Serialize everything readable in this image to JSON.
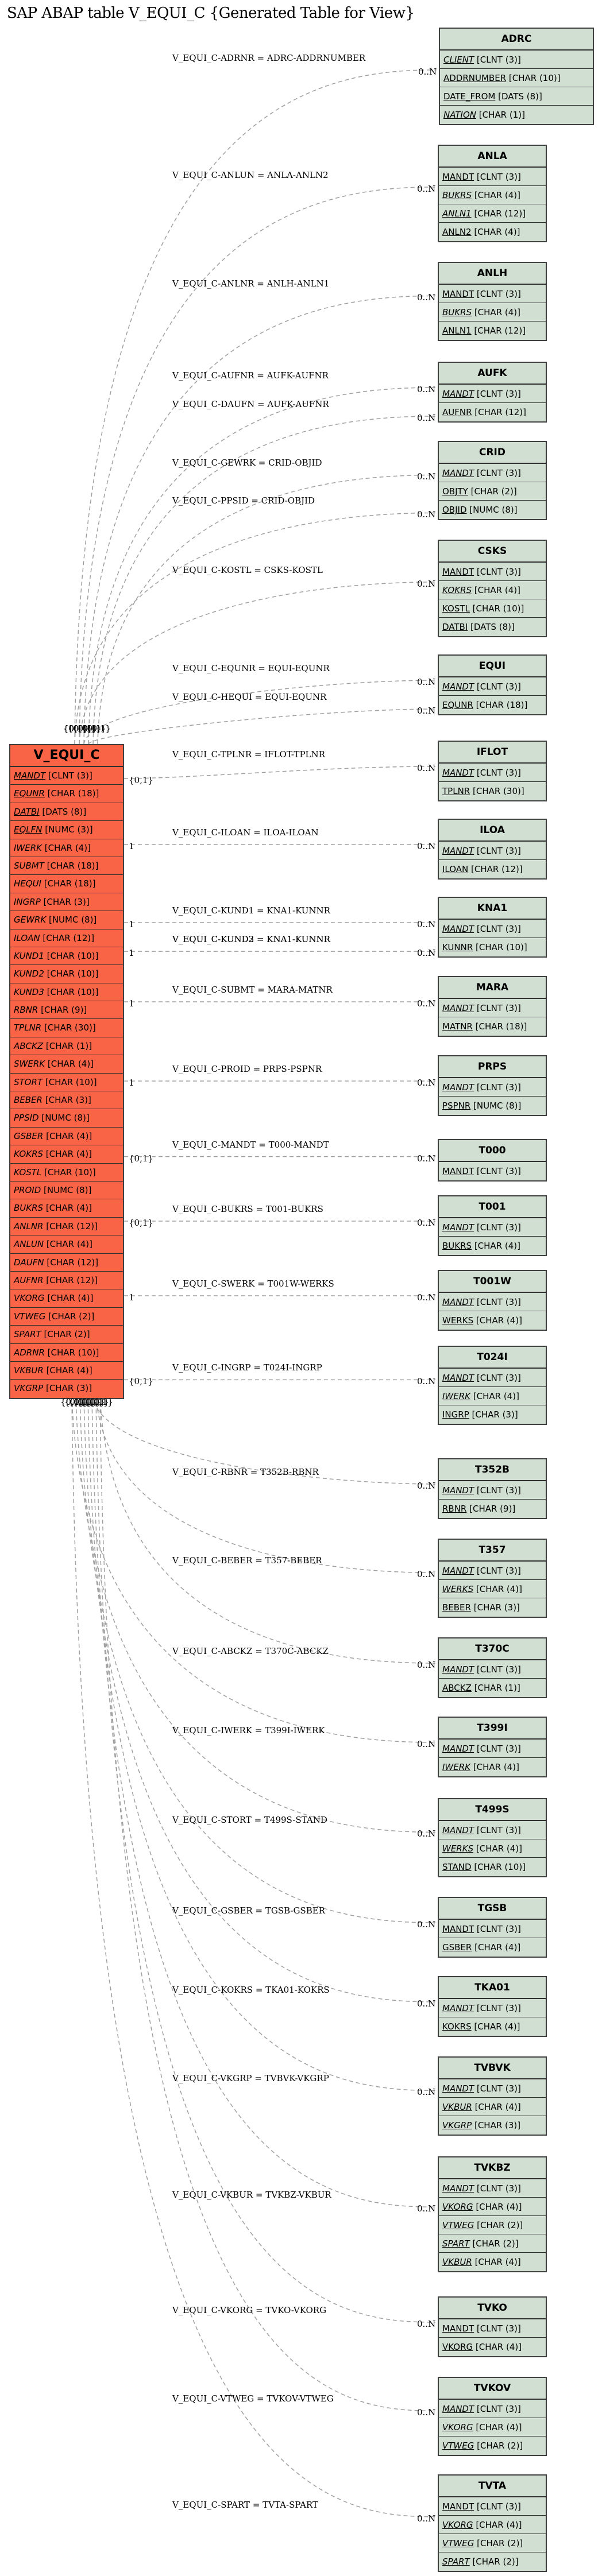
{
  "title": "SAP ABAP table V_EQUI_C {Generated Table for View}",
  "colors": {
    "main_fill": "#f96447",
    "ref_fill": "#d0dfd1",
    "edge": "#a0a0a0",
    "border": "#404040"
  },
  "main_entity": {
    "name": "V_EQUI_C",
    "fields": [
      {
        "name": "MANDT",
        "type": "[CLNT (3)]",
        "key": true
      },
      {
        "name": "EQUNR",
        "type": "[CHAR (18)]",
        "key": true
      },
      {
        "name": "DATBI",
        "type": "[DATS (8)]",
        "key": true
      },
      {
        "name": "EQLFN",
        "type": "[NUMC (3)]",
        "key": true
      },
      {
        "name": "IWERK",
        "type": "[CHAR (4)]",
        "key": false
      },
      {
        "name": "SUBMT",
        "type": "[CHAR (18)]",
        "key": false
      },
      {
        "name": "HEQUI",
        "type": "[CHAR (18)]",
        "key": false
      },
      {
        "name": "INGRP",
        "type": "[CHAR (3)]",
        "key": false
      },
      {
        "name": "GEWRK",
        "type": "[NUMC (8)]",
        "key": false
      },
      {
        "name": "ILOAN",
        "type": "[CHAR (12)]",
        "key": false
      },
      {
        "name": "KUND1",
        "type": "[CHAR (10)]",
        "key": false
      },
      {
        "name": "KUND2",
        "type": "[CHAR (10)]",
        "key": false
      },
      {
        "name": "KUND3",
        "type": "[CHAR (10)]",
        "key": false
      },
      {
        "name": "RBNR",
        "type": "[CHAR (9)]",
        "key": false
      },
      {
        "name": "TPLNR",
        "type": "[CHAR (30)]",
        "key": false
      },
      {
        "name": "ABCKZ",
        "type": "[CHAR (1)]",
        "key": false
      },
      {
        "name": "SWERK",
        "type": "[CHAR (4)]",
        "key": false
      },
      {
        "name": "STORT",
        "type": "[CHAR (10)]",
        "key": false
      },
      {
        "name": "BEBER",
        "type": "[CHAR (3)]",
        "key": false
      },
      {
        "name": "PPSID",
        "type": "[NUMC (8)]",
        "key": false
      },
      {
        "name": "GSBER",
        "type": "[CHAR (4)]",
        "key": false
      },
      {
        "name": "KOKRS",
        "type": "[CHAR (4)]",
        "key": false
      },
      {
        "name": "KOSTL",
        "type": "[CHAR (10)]",
        "key": false
      },
      {
        "name": "PROID",
        "type": "[NUMC (8)]",
        "key": false
      },
      {
        "name": "BUKRS",
        "type": "[CHAR (4)]",
        "key": false
      },
      {
        "name": "ANLNR",
        "type": "[CHAR (12)]",
        "key": false
      },
      {
        "name": "ANLUN",
        "type": "[CHAR (4)]",
        "key": false
      },
      {
        "name": "DAUFN",
        "type": "[CHAR (12)]",
        "key": false
      },
      {
        "name": "AUFNR",
        "type": "[CHAR (12)]",
        "key": false
      },
      {
        "name": "VKORG",
        "type": "[CHAR (4)]",
        "key": false
      },
      {
        "name": "VTWEG",
        "type": "[CHAR (2)]",
        "key": false
      },
      {
        "name": "SPART",
        "type": "[CHAR (2)]",
        "key": false
      },
      {
        "name": "ADRNR",
        "type": "[CHAR (10)]",
        "key": false
      },
      {
        "name": "VKBUR",
        "type": "[CHAR (4)]",
        "key": false
      },
      {
        "name": "VKGRP",
        "type": "[CHAR (3)]",
        "key": false
      }
    ]
  },
  "entities": [
    {
      "name": "ADRC",
      "fields": [
        {
          "name": "CLIENT",
          "type": "[CLNT (3)]",
          "italic": true
        },
        {
          "name": "ADDRNUMBER",
          "type": "[CHAR (10)]",
          "italic": false
        },
        {
          "name": "DATE_FROM",
          "type": "[DATS (8)]",
          "italic": false
        },
        {
          "name": "NATION",
          "type": "[CHAR (1)]",
          "italic": true
        }
      ]
    },
    {
      "name": "ANLA",
      "fields": [
        {
          "name": "MANDT",
          "type": "[CLNT (3)]",
          "italic": false
        },
        {
          "name": "BUKRS",
          "type": "[CHAR (4)]",
          "italic": true
        },
        {
          "name": "ANLN1",
          "type": "[CHAR (12)]",
          "italic": true
        },
        {
          "name": "ANLN2",
          "type": "[CHAR (4)]",
          "italic": false
        }
      ]
    },
    {
      "name": "ANLH",
      "fields": [
        {
          "name": "MANDT",
          "type": "[CLNT (3)]",
          "italic": false
        },
        {
          "name": "BUKRS",
          "type": "[CHAR (4)]",
          "italic": true
        },
        {
          "name": "ANLN1",
          "type": "[CHAR (12)]",
          "italic": false
        }
      ]
    },
    {
      "name": "AUFK",
      "fields": [
        {
          "name": "MANDT",
          "type": "[CLNT (3)]",
          "italic": true
        },
        {
          "name": "AUFNR",
          "type": "[CHAR (12)]",
          "italic": false
        }
      ]
    },
    {
      "name": "CRID",
      "fields": [
        {
          "name": "MANDT",
          "type": "[CLNT (3)]",
          "italic": true
        },
        {
          "name": "OBJTY",
          "type": "[CHAR (2)]",
          "italic": false
        },
        {
          "name": "OBJID",
          "type": "[NUMC (8)]",
          "italic": false
        }
      ]
    },
    {
      "name": "CSKS",
      "fields": [
        {
          "name": "MANDT",
          "type": "[CLNT (3)]",
          "italic": false
        },
        {
          "name": "KOKRS",
          "type": "[CHAR (4)]",
          "italic": true
        },
        {
          "name": "KOSTL",
          "type": "[CHAR (10)]",
          "italic": false
        },
        {
          "name": "DATBI",
          "type": "[DATS (8)]",
          "italic": false
        }
      ]
    },
    {
      "name": "EQUI",
      "fields": [
        {
          "name": "MANDT",
          "type": "[CLNT (3)]",
          "italic": true
        },
        {
          "name": "EQUNR",
          "type": "[CHAR (18)]",
          "italic": false
        }
      ]
    },
    {
      "name": "IFLOT",
      "fields": [
        {
          "name": "MANDT",
          "type": "[CLNT (3)]",
          "italic": true
        },
        {
          "name": "TPLNR",
          "type": "[CHAR (30)]",
          "italic": false
        }
      ]
    },
    {
      "name": "ILOA",
      "fields": [
        {
          "name": "MANDT",
          "type": "[CLNT (3)]",
          "italic": true
        },
        {
          "name": "ILOAN",
          "type": "[CHAR (12)]",
          "italic": false
        }
      ]
    },
    {
      "name": "KNA1",
      "fields": [
        {
          "name": "MANDT",
          "type": "[CLNT (3)]",
          "italic": true
        },
        {
          "name": "KUNNR",
          "type": "[CHAR (10)]",
          "italic": false
        }
      ]
    },
    {
      "name": "MARA",
      "fields": [
        {
          "name": "MANDT",
          "type": "[CLNT (3)]",
          "italic": true
        },
        {
          "name": "MATNR",
          "type": "[CHAR (18)]",
          "italic": false
        }
      ]
    },
    {
      "name": "PRPS",
      "fields": [
        {
          "name": "MANDT",
          "type": "[CLNT (3)]",
          "italic": true
        },
        {
          "name": "PSPNR",
          "type": "[NUMC (8)]",
          "italic": false
        }
      ]
    },
    {
      "name": "T000",
      "fields": [
        {
          "name": "MANDT",
          "type": "[CLNT (3)]",
          "italic": false
        }
      ]
    },
    {
      "name": "T001",
      "fields": [
        {
          "name": "MANDT",
          "type": "[CLNT (3)]",
          "italic": true
        },
        {
          "name": "BUKRS",
          "type": "[CHAR (4)]",
          "italic": false
        }
      ]
    },
    {
      "name": "T001W",
      "fields": [
        {
          "name": "MANDT",
          "type": "[CLNT (3)]",
          "italic": true
        },
        {
          "name": "WERKS",
          "type": "[CHAR (4)]",
          "italic": false
        }
      ]
    },
    {
      "name": "T024I",
      "fields": [
        {
          "name": "MANDT",
          "type": "[CLNT (3)]",
          "italic": true
        },
        {
          "name": "IWERK",
          "type": "[CHAR (4)]",
          "italic": true
        },
        {
          "name": "INGRP",
          "type": "[CHAR (3)]",
          "italic": false
        }
      ]
    },
    {
      "name": "T352B",
      "fields": [
        {
          "name": "MANDT",
          "type": "[CLNT (3)]",
          "italic": true
        },
        {
          "name": "RBNR",
          "type": "[CHAR (9)]",
          "italic": false
        }
      ]
    },
    {
      "name": "T357",
      "fields": [
        {
          "name": "MANDT",
          "type": "[CLNT (3)]",
          "italic": true
        },
        {
          "name": "WERKS",
          "type": "[CHAR (4)]",
          "italic": true
        },
        {
          "name": "BEBER",
          "type": "[CHAR (3)]",
          "italic": false
        }
      ]
    },
    {
      "name": "T370C",
      "fields": [
        {
          "name": "MANDT",
          "type": "[CLNT (3)]",
          "italic": true
        },
        {
          "name": "ABCKZ",
          "type": "[CHAR (1)]",
          "italic": false
        }
      ]
    },
    {
      "name": "T399I",
      "fields": [
        {
          "name": "MANDT",
          "type": "[CLNT (3)]",
          "italic": true
        },
        {
          "name": "IWERK",
          "type": "[CHAR (4)]",
          "italic": true
        }
      ]
    },
    {
      "name": "T499S",
      "fields": [
        {
          "name": "MANDT",
          "type": "[CLNT (3)]",
          "italic": true
        },
        {
          "name": "WERKS",
          "type": "[CHAR (4)]",
          "italic": true
        },
        {
          "name": "STAND",
          "type": "[CHAR (10)]",
          "italic": false
        }
      ]
    },
    {
      "name": "TGSB",
      "fields": [
        {
          "name": "MANDT",
          "type": "[CLNT (3)]",
          "italic": false
        },
        {
          "name": "GSBER",
          "type": "[CHAR (4)]",
          "italic": false
        }
      ]
    },
    {
      "name": "TKA01",
      "fields": [
        {
          "name": "MANDT",
          "type": "[CLNT (3)]",
          "italic": true
        },
        {
          "name": "KOKRS",
          "type": "[CHAR (4)]",
          "italic": false
        }
      ]
    },
    {
      "name": "TVBVK",
      "fields": [
        {
          "name": "MANDT",
          "type": "[CLNT (3)]",
          "italic": true
        },
        {
          "name": "VKBUR",
          "type": "[CHAR (4)]",
          "italic": true
        },
        {
          "name": "VKGRP",
          "type": "[CHAR (3)]",
          "italic": true
        }
      ]
    },
    {
      "name": "TVKBZ",
      "fields": [
        {
          "name": "MANDT",
          "type": "[CLNT (3)]",
          "italic": true
        },
        {
          "name": "VKORG",
          "type": "[CHAR (4)]",
          "italic": true
        },
        {
          "name": "VTWEG",
          "type": "[CHAR (2)]",
          "italic": true
        },
        {
          "name": "SPART",
          "type": "[CHAR (2)]",
          "italic": true
        },
        {
          "name": "VKBUR",
          "type": "[CHAR (4)]",
          "italic": true
        }
      ]
    },
    {
      "name": "TVKO",
      "fields": [
        {
          "name": "MANDT",
          "type": "[CLNT (3)]",
          "italic": false
        },
        {
          "name": "VKORG",
          "type": "[CHAR (4)]",
          "italic": false
        }
      ]
    },
    {
      "name": "TVKOV",
      "fields": [
        {
          "name": "MANDT",
          "type": "[CLNT (3)]",
          "italic": true
        },
        {
          "name": "VKORG",
          "type": "[CHAR (4)]",
          "italic": true
        },
        {
          "name": "VTWEG",
          "type": "[CHAR (2)]",
          "italic": true
        }
      ]
    },
    {
      "name": "TVTA",
      "fields": [
        {
          "name": "MANDT",
          "type": "[CLNT (3)]",
          "italic": false
        },
        {
          "name": "VKORG",
          "type": "[CHAR (4)]",
          "italic": true
        },
        {
          "name": "VTWEG",
          "type": "[CHAR (2)]",
          "italic": true
        },
        {
          "name": "SPART",
          "type": "[CHAR (2)]",
          "italic": true
        }
      ]
    }
  ],
  "relations": [
    {
      "label": "V_EQUI_C-ADRNR = ADRC-ADDRNUMBER",
      "target": "ADRC",
      "target_card": "0..N",
      "source_card": "{0,1}"
    },
    {
      "label": "V_EQUI_C-ANLUN = ANLA-ANLN2",
      "target": "ANLA",
      "target_card": "0..N",
      "source_card": "{0,1}"
    },
    {
      "label": "V_EQUI_C-ANLNR = ANLH-ANLN1",
      "target": "ANLH",
      "target_card": "0..N",
      "source_card": "{0,1}"
    },
    {
      "label": "V_EQUI_C-AUFNR = AUFK-AUFNR",
      "target": "AUFK",
      "target_card": "0..N",
      "source_card": "{0,1}"
    },
    {
      "label": "V_EQUI_C-DAUFN = AUFK-AUFNR",
      "target": "AUFK",
      "target_card": "0..N",
      "source_card": "{0,1}"
    },
    {
      "label": "V_EQUI_C-GEWRK = CRID-OBJID",
      "target": "CRID",
      "target_card": "0..N",
      "source_card": "{0,1}"
    },
    {
      "label": "V_EQUI_C-PPSID = CRID-OBJID",
      "target": "CRID",
      "target_card": "0..N",
      "source_card": "{0,1}"
    },
    {
      "label": "V_EQUI_C-KOSTL = CSKS-KOSTL",
      "target": "CSKS",
      "target_card": "0..N",
      "source_card": "1"
    },
    {
      "label": "V_EQUI_C-EQUNR = EQUI-EQUNR",
      "target": "EQUI",
      "target_card": "0..N",
      "source_card": "{0,1}"
    },
    {
      "label": "V_EQUI_C-HEQUI = EQUI-EQUNR",
      "target": "EQUI",
      "target_card": "0..N",
      "source_card": "{0,1}"
    },
    {
      "label": "V_EQUI_C-TPLNR = IFLOT-TPLNR",
      "target": "IFLOT",
      "target_card": "0..N",
      "source_card": "{0,1}"
    },
    {
      "label": "V_EQUI_C-ILOAN = ILOA-ILOAN",
      "target": "ILOA",
      "target_card": "0..N",
      "source_card": "1"
    },
    {
      "label": "V_EQUI_C-KUND1 = KNA1-KUNNR",
      "target": "KNA1",
      "target_card": "0..N",
      "source_card": "1"
    },
    {
      "label": "V_EQUI_C-KUND2 = KNA1-KUNNR",
      "target": "KNA1",
      "target_card": "0..N",
      "source_card": "1"
    },
    {
      "label": "V_EQUI_C-KUND3 = KNA1-KUNNR",
      "target": "KNA1",
      "target_card": "0..N",
      "source_card": "1"
    },
    {
      "label": "V_EQUI_C-SUBMT = MARA-MATNR",
      "target": "MARA",
      "target_card": "0..N",
      "source_card": "1"
    },
    {
      "label": "V_EQUI_C-PROID = PRPS-PSPNR",
      "target": "PRPS",
      "target_card": "0..N",
      "source_card": "1"
    },
    {
      "label": "V_EQUI_C-MANDT = T000-MANDT",
      "target": "T000",
      "target_card": "0..N",
      "source_card": "{0,1}"
    },
    {
      "label": "V_EQUI_C-BUKRS = T001-BUKRS",
      "target": "T001",
      "target_card": "0..N",
      "source_card": "{0,1}"
    },
    {
      "label": "V_EQUI_C-SWERK = T001W-WERKS",
      "target": "T001W",
      "target_card": "0..N",
      "source_card": "1"
    },
    {
      "label": "V_EQUI_C-INGRP = T024I-INGRP",
      "target": "T024I",
      "target_card": "0..N",
      "source_card": "{0,1}"
    },
    {
      "label": "V_EQUI_C-RBNR = T352B-RBNR",
      "target": "T352B",
      "target_card": "0..N",
      "source_card": "{0,1}"
    },
    {
      "label": "V_EQUI_C-BEBER = T357-BEBER",
      "target": "T357",
      "target_card": "0..N",
      "source_card": "{0,1}"
    },
    {
      "label": "V_EQUI_C-ABCKZ = T370C-ABCKZ",
      "target": "T370C",
      "target_card": "0..N",
      "source_card": "{0,1}"
    },
    {
      "label": "V_EQUI_C-IWERK = T399I-IWERK",
      "target": "T399I",
      "target_card": "0..N",
      "source_card": "{0,1}"
    },
    {
      "label": "V_EQUI_C-STORT = T499S-STAND",
      "target": "T499S",
      "target_card": "0..N",
      "source_card": "{0,1}"
    },
    {
      "label": "V_EQUI_C-GSBER = TGSB-GSBER",
      "target": "TGSB",
      "target_card": "0..N",
      "source_card": "{0,1}"
    },
    {
      "label": "V_EQUI_C-KOKRS = TKA01-KOKRS",
      "target": "TKA01",
      "target_card": "0..N",
      "source_card": "{0,1}"
    },
    {
      "label": "V_EQUI_C-VKGRP = TVBVK-VKGRP",
      "target": "TVBVK",
      "target_card": "0..N",
      "source_card": "{0,1}"
    },
    {
      "label": "V_EQUI_C-VKBUR = TVKBZ-VKBUR",
      "target": "TVKBZ",
      "target_card": "0..N",
      "source_card": "{0,1}"
    },
    {
      "label": "V_EQUI_C-VKORG = TVKO-VKORG",
      "target": "TVKO",
      "target_card": "0..N",
      "source_card": "{0,1}"
    },
    {
      "label": "V_EQUI_C-VTWEG = TVKOV-VTWEG",
      "target": "TVKOV",
      "target_card": "0..N",
      "source_card": "{0,1}"
    },
    {
      "label": "V_EQUI_C-SPART = TVTA-SPART",
      "target": "TVTA",
      "target_card": "0..N",
      "source_card": "{0,1}"
    }
  ]
}
